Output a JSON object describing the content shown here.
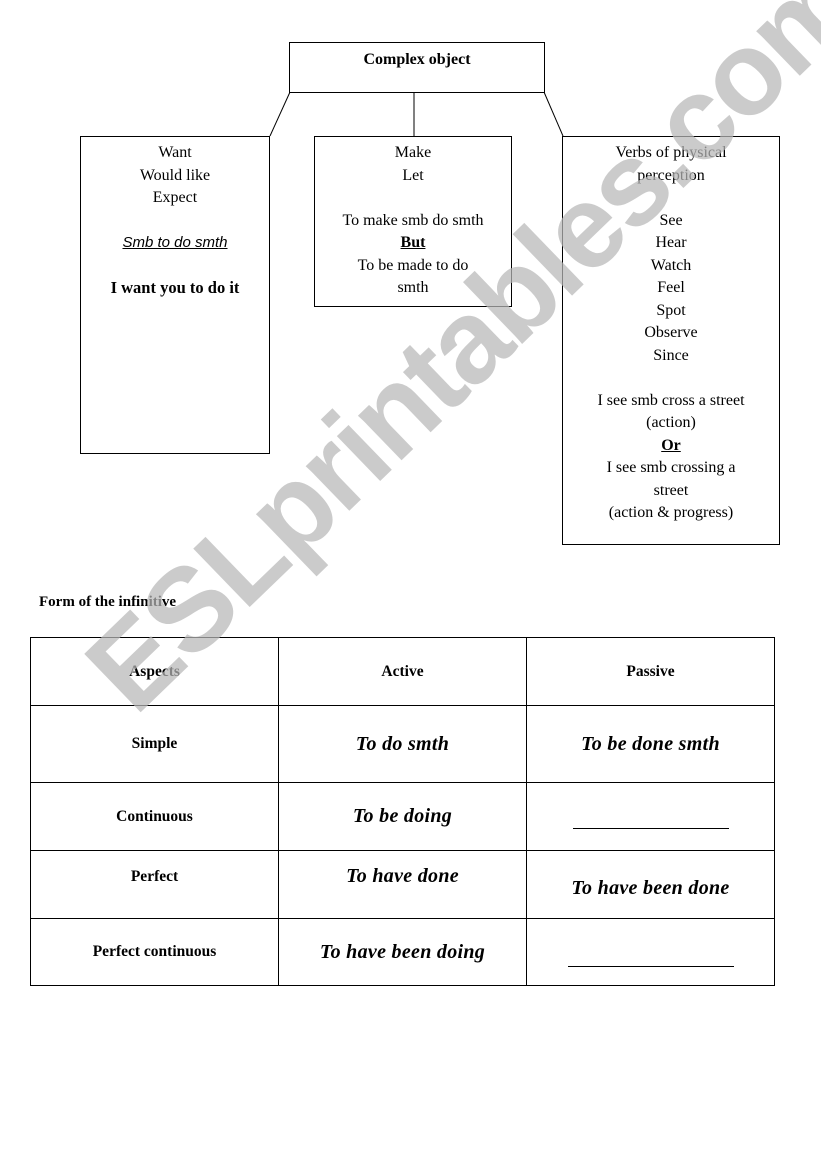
{
  "diagram": {
    "root": "Complex object",
    "boxes": {
      "want": {
        "verbs": [
          "Want",
          "Would like",
          "Expect"
        ],
        "pattern": "Smb to do smth",
        "example": "I want you to do it"
      },
      "make": {
        "verbs": [
          "Make",
          "Let"
        ],
        "active_pattern": "To make smb do smth",
        "contrast_word": "But",
        "passive_pattern_line1": "To be made to do",
        "passive_pattern_line2": "smth"
      },
      "perception": {
        "title_line1": "Verbs of physical",
        "title_line2": "perception",
        "verbs": [
          "See",
          "Hear",
          "Watch",
          "Feel",
          "Spot",
          "Observe",
          "Since"
        ],
        "example1": "I see smb cross a street",
        "example1_note": "(action)",
        "contrast_word": "Or",
        "example2_line1": "I see smb crossing a",
        "example2_line2": "street",
        "example2_note": "(action & progress)"
      }
    }
  },
  "infinitive_table": {
    "title": "Form of the infinitive",
    "headers": [
      "Aspects",
      "Active",
      "Passive"
    ],
    "rows": [
      {
        "aspect": "Simple",
        "active": "To do smth",
        "passive": "To be done smth"
      },
      {
        "aspect": "Continuous",
        "active": "To be doing",
        "passive": ""
      },
      {
        "aspect": "Perfect",
        "active": "To have done",
        "passive": "To have been done"
      },
      {
        "aspect": "Perfect continuous",
        "active": "To have been doing",
        "passive": ""
      }
    ]
  },
  "watermark": "ESLprintables.com"
}
